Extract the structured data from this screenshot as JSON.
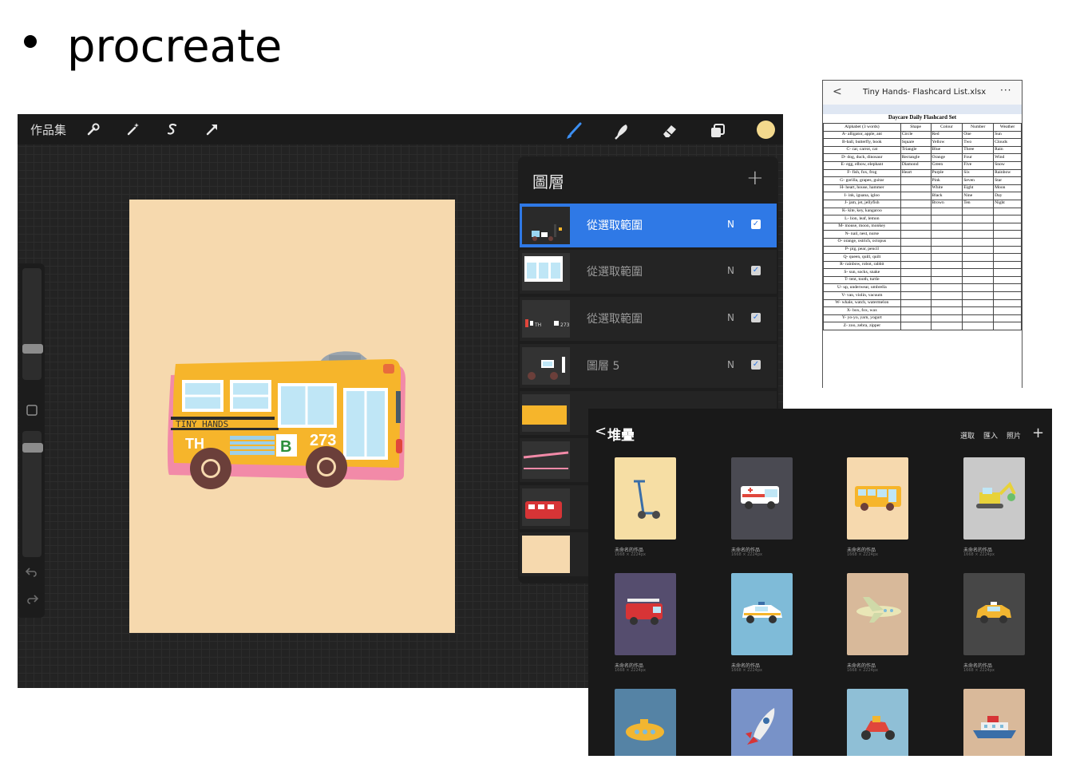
{
  "slide": {
    "title": "procreate"
  },
  "procreate": {
    "gallery_label": "作品集",
    "tools": [
      "wrench-icon",
      "magic-wand-icon",
      "selection-icon",
      "transform-arrow-icon",
      "brush-icon",
      "smudge-icon",
      "eraser-icon",
      "layers-icon"
    ],
    "color_swatch": "#f3d98d",
    "canvas_color": "#f6d9ae",
    "bus_text": {
      "brand": "TINY HANDS",
      "initials": "TH",
      "letter": "B",
      "route": "273"
    }
  },
  "layers": {
    "title": "圖層",
    "add_icon": "+",
    "items": [
      {
        "name": "從選取範圍",
        "mode": "N",
        "checked": true,
        "active": true
      },
      {
        "name": "從選取範圍",
        "mode": "N",
        "checked": true,
        "active": false
      },
      {
        "name": "從選取範圍",
        "mode": "N",
        "checked": true,
        "active": false
      },
      {
        "name": "圖層 5",
        "mode": "N",
        "checked": true,
        "active": false
      }
    ],
    "thumb_labels": {
      "th": "TH",
      "route": "273"
    }
  },
  "spreadsheet": {
    "title": "Tiny Hands- Flashcard List.xlsx",
    "back_icon": "<",
    "more_icon": "···",
    "caption": "Daycare Daily Flashcard Set",
    "headers": [
      "Alphabet (3 words)",
      "Shape",
      "Colour",
      "Number",
      "Weather"
    ],
    "rows": [
      [
        "A- alligator, apple, ant",
        "Circle",
        "Red",
        "One",
        "Sun"
      ],
      [
        "B-ball, butterfly, book",
        "Square",
        "Yellow",
        "Two",
        "Clouds"
      ],
      [
        "C- car, carrot, cat",
        "Triangle",
        "Blue",
        "Three",
        "Rain"
      ],
      [
        "D- dog, duck, dinosaur",
        "Rectangle",
        "Orange",
        "Four",
        "Wind"
      ],
      [
        "E- egg, elbow, elephant",
        "Diamond",
        "Green",
        "Five",
        "Snow"
      ],
      [
        "F- fish, fox, frog",
        "Heart",
        "Purple",
        "Six",
        "Rainbow"
      ],
      [
        "G- gorilla, grapes, guitar",
        "",
        "Pink",
        "Seven",
        "Star"
      ],
      [
        "H- heart, house, hammer",
        "",
        "White",
        "Eight",
        "Moon"
      ],
      [
        "I- ink, iguana, igloo",
        "",
        "Black",
        "Nine",
        "Day"
      ],
      [
        "J- jam, jet, jellyfish",
        "",
        "Brown",
        "Ten",
        "Night"
      ],
      [
        "K- kite, key, kangaroo",
        "",
        "",
        "",
        ""
      ],
      [
        "L- lion, leaf, lemon",
        "",
        "",
        "",
        ""
      ],
      [
        "M- mouse, moon, monkey",
        "",
        "",
        "",
        ""
      ],
      [
        "N- nail, nest, nurse",
        "",
        "",
        "",
        ""
      ],
      [
        "O- orange, ostrich, octopus",
        "",
        "",
        "",
        ""
      ],
      [
        "P- pig, pear, pencil",
        "",
        "",
        "",
        ""
      ],
      [
        "Q- queen, quill, quilt",
        "",
        "",
        "",
        ""
      ],
      [
        "R- rainbow, robot, rabbit",
        "",
        "",
        "",
        ""
      ],
      [
        "S- sun, socks, snake",
        "",
        "",
        "",
        ""
      ],
      [
        "T- tent, tooth, turtle",
        "",
        "",
        "",
        ""
      ],
      [
        "U- up, underwear, umbrella",
        "",
        "",
        "",
        ""
      ],
      [
        "V- van, violin, vacuum",
        "",
        "",
        "",
        ""
      ],
      [
        "W- whale, watch, watermelon",
        "",
        "",
        "",
        ""
      ],
      [
        "X- box, fox, wax",
        "",
        "",
        "",
        ""
      ],
      [
        "Y- yo-yo, yarn, yogurt",
        "",
        "",
        "",
        ""
      ],
      [
        "Z- zoo, zebra, zipper",
        "",
        "",
        "",
        ""
      ]
    ]
  },
  "gallery": {
    "back_icon": "<",
    "title": "堆疊",
    "actions": [
      "選取",
      "匯入",
      "照片"
    ],
    "add_icon": "+",
    "cards": [
      {
        "name": "未命名的作品",
        "size": "1668 × 2224px",
        "bg": "#f6dea4",
        "icon": "scooter-icon"
      },
      {
        "name": "未命名的作品",
        "size": "1668 × 2224px",
        "bg": "#4a4a52",
        "icon": "ambulance-icon"
      },
      {
        "name": "未命名的作品",
        "size": "1668 × 2224px",
        "bg": "#f6d9ae",
        "icon": "bus-icon"
      },
      {
        "name": "未命名的作品",
        "size": "1668 × 2224px",
        "bg": "#c9c9c9",
        "icon": "excavator-icon"
      },
      {
        "name": "未命名的作品",
        "size": "1668 × 2224px",
        "bg": "#554d6e",
        "icon": "fire-truck-icon"
      },
      {
        "name": "未命名的作品",
        "size": "1668 × 2224px",
        "bg": "#7fbbd8",
        "icon": "police-car-icon"
      },
      {
        "name": "未命名的作品",
        "size": "1668 × 2224px",
        "bg": "#d8b99a",
        "icon": "airplane-icon"
      },
      {
        "name": "未命名的作品",
        "size": "1668 × 2224px",
        "bg": "#474747",
        "icon": "taxi-icon"
      },
      {
        "name": "",
        "size": "",
        "bg": "#5583a5",
        "icon": "submarine-icon"
      },
      {
        "name": "",
        "size": "",
        "bg": "#7892c8",
        "icon": "rocket-icon"
      },
      {
        "name": "",
        "size": "",
        "bg": "#8fbfd6",
        "icon": "motor-scooter-icon"
      },
      {
        "name": "",
        "size": "",
        "bg": "#d9b99a",
        "icon": "ship-icon"
      }
    ]
  }
}
